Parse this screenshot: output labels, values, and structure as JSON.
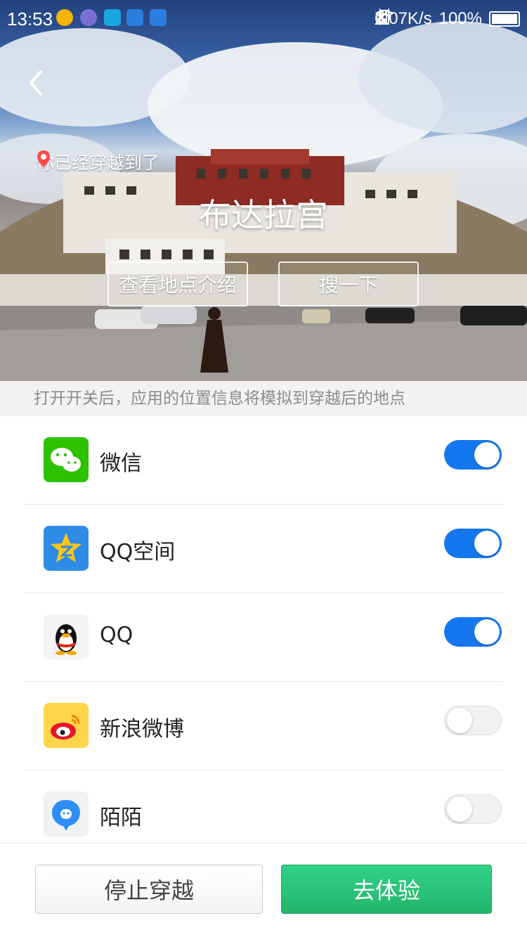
{
  "status_bar": {
    "time": "13:53",
    "network_speed": "0.07K/s",
    "battery": "100%",
    "icons": [
      "plus-app-icon",
      "browser-app-icon",
      "scan-app-icon",
      "bluetooth-app-icon",
      "bluetooth-app-icon",
      "bluetooth-icon",
      "vibrate-icon",
      "wifi-icon",
      "signal-icon",
      "signal-icon",
      "battery-icon"
    ]
  },
  "header": {
    "location_hint": "你已经穿越到了",
    "place_name": "布达拉宫",
    "intro_button": "查看地点介绍",
    "search_button": "搜一下"
  },
  "info_text": "打开开关后，应用的位置信息将模拟到穿越后的地点",
  "apps": [
    {
      "name": "微信",
      "icon": "wechat-icon",
      "enabled": true
    },
    {
      "name": "QQ空间",
      "icon": "qzone-icon",
      "enabled": true
    },
    {
      "name": "QQ",
      "icon": "qq-icon",
      "enabled": true
    },
    {
      "name": "新浪微博",
      "icon": "weibo-icon",
      "enabled": false
    },
    {
      "name": "陌陌",
      "icon": "momo-icon",
      "enabled": false
    }
  ],
  "footer": {
    "stop_button": "停止穿越",
    "go_button": "去体验"
  },
  "colors": {
    "toggle_on": "#1577f0",
    "primary_green": "#22b56c",
    "info_text": "#8c8c8c"
  }
}
